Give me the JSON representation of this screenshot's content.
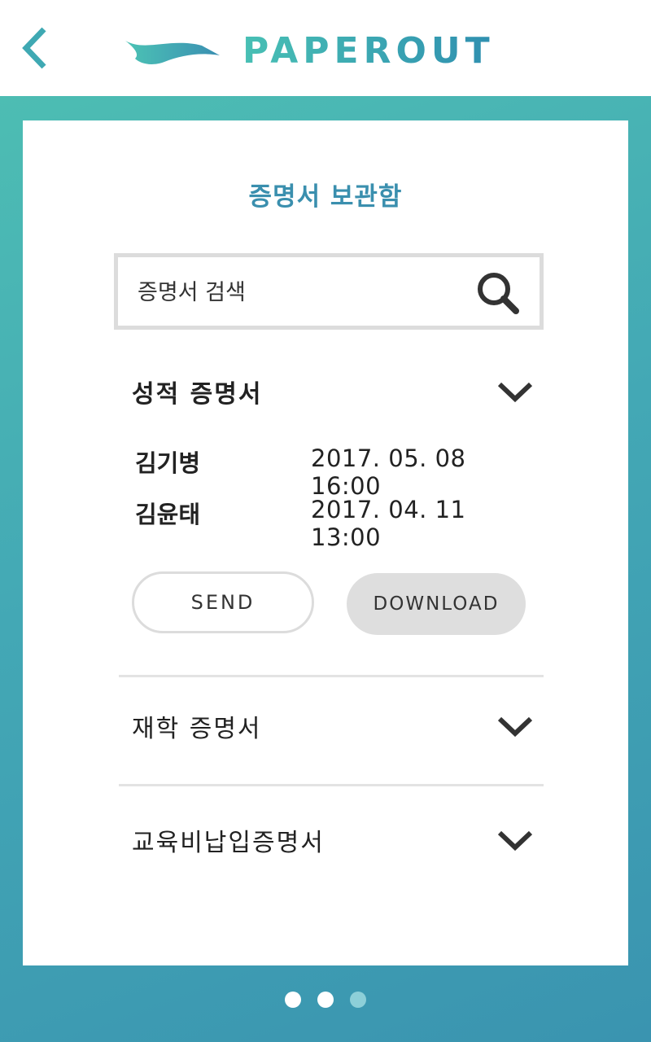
{
  "header": {
    "logo_text": "PAPEROUT"
  },
  "card": {
    "title": "증명서 보관함",
    "search": {
      "placeholder": "증명서 검색"
    },
    "sections": [
      {
        "label": "성적 증명서",
        "expanded": true,
        "records": [
          {
            "name": "김기병",
            "datetime": "2017. 05. 08  16:00"
          },
          {
            "name": "김윤태",
            "datetime": "2017. 04. 11  13:00"
          }
        ],
        "send_label": "SEND",
        "download_label": "DOWNLOAD"
      },
      {
        "label": "재학 증명서",
        "expanded": false
      },
      {
        "label": "교육비납입증명서",
        "expanded": false
      }
    ]
  },
  "pagination": {
    "count": 3,
    "active_index": 1
  },
  "colors": {
    "accent": "#3a8fae",
    "teal": "#4dbdb3",
    "dot_active": "#ffffff",
    "dot_inactive": "#8dcfd8"
  }
}
